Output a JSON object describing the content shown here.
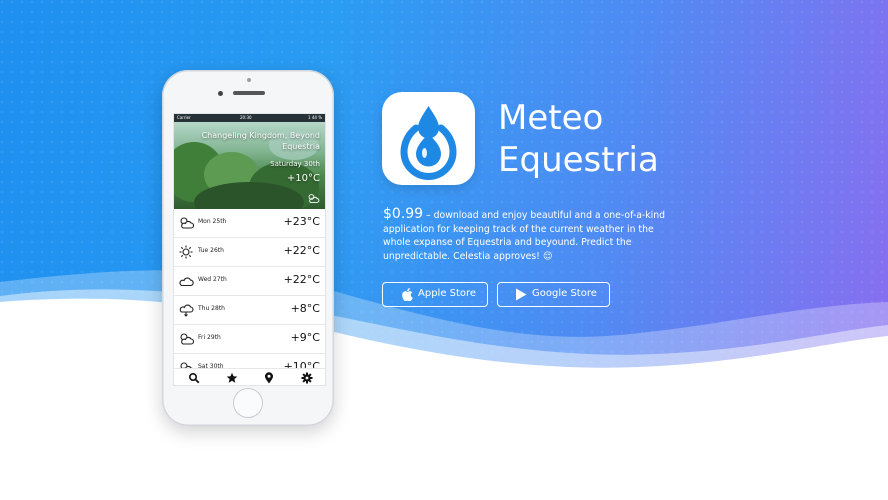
{
  "app": {
    "name_line1": "Meteo",
    "name_line2": "Equestria",
    "price": "$0.99",
    "description": " – download and enjoy beautiful and a one-of-a-kind application for keeping track of the current weather in the whole expanse of Equestria and beyound. Predict the unpredictable. Celestia approves! 😌"
  },
  "buttons": {
    "apple": "Apple Store",
    "google": "Google Store"
  },
  "phone": {
    "status": {
      "carrier": "Carrier",
      "time": "20:30",
      "battery": "1 44 %"
    },
    "location": "Changeling Kingdom, Beyond Equestria",
    "date": "Saturday 30th",
    "current_temp": "+10°C",
    "forecast": [
      {
        "day": "Mon 25th",
        "temp": "+23°C",
        "icon": "partly-cloudy-icon"
      },
      {
        "day": "Tue 26th",
        "temp": "+22°C",
        "icon": "sun-icon"
      },
      {
        "day": "Wed 27th",
        "temp": "+22°C",
        "icon": "cloud-icon"
      },
      {
        "day": "Thu 28th",
        "temp": "+8°C",
        "icon": "rain-cloud-icon"
      },
      {
        "day": "Fri 29th",
        "temp": "+9°C",
        "icon": "partly-cloudy-icon"
      },
      {
        "day": "Sat 30th",
        "temp": "+10°C",
        "icon": "partly-cloudy-icon"
      }
    ],
    "tabs": [
      "search-icon",
      "star-icon",
      "location-pin-icon",
      "gear-icon"
    ]
  },
  "colors": {
    "gradient_start": "#1f8ff0",
    "gradient_end": "#8c6cf0",
    "icon_blue": "#1e88e5",
    "wave": "#ffffff"
  }
}
